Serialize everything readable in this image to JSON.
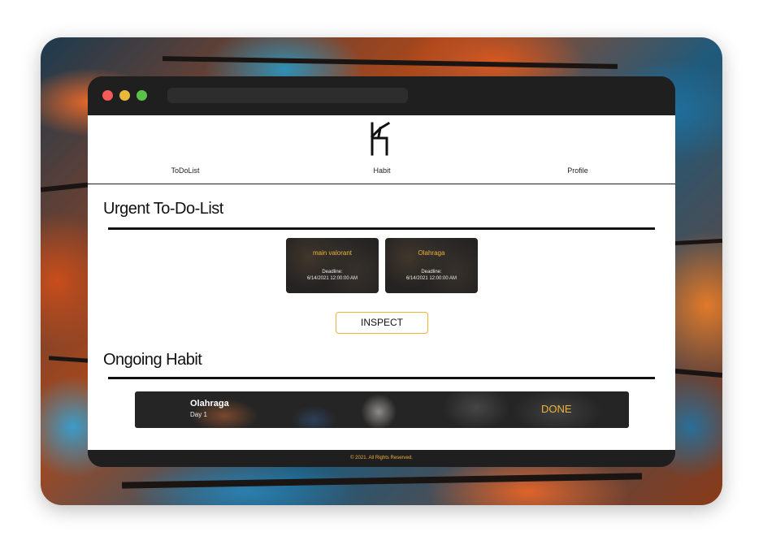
{
  "nav": {
    "items": [
      {
        "label": "ToDoList"
      },
      {
        "label": "Habit"
      },
      {
        "label": "Profile"
      }
    ]
  },
  "urgent": {
    "title": "Urgent To-Do-List",
    "cards": [
      {
        "title": "main valorant",
        "deadline_label": "Deadline:",
        "deadline": "6/14/2021 12:00:00 AM"
      },
      {
        "title": "Olahraga",
        "deadline_label": "Deadline:",
        "deadline": "6/14/2021 12:00:00 AM"
      }
    ],
    "inspect_label": "INSPECT"
  },
  "habit": {
    "title": "Ongoing Habit",
    "item": {
      "name": "Olahraga",
      "day": "Day 1",
      "action": "DONE"
    }
  },
  "footer": {
    "text": "© 2021. All Rights Reserved."
  },
  "colors": {
    "accent": "#f0b13a",
    "window_chrome": "#1f1f1f",
    "traffic_red": "#f25b57",
    "traffic_yellow": "#e8b73c",
    "traffic_green": "#5bc148"
  }
}
